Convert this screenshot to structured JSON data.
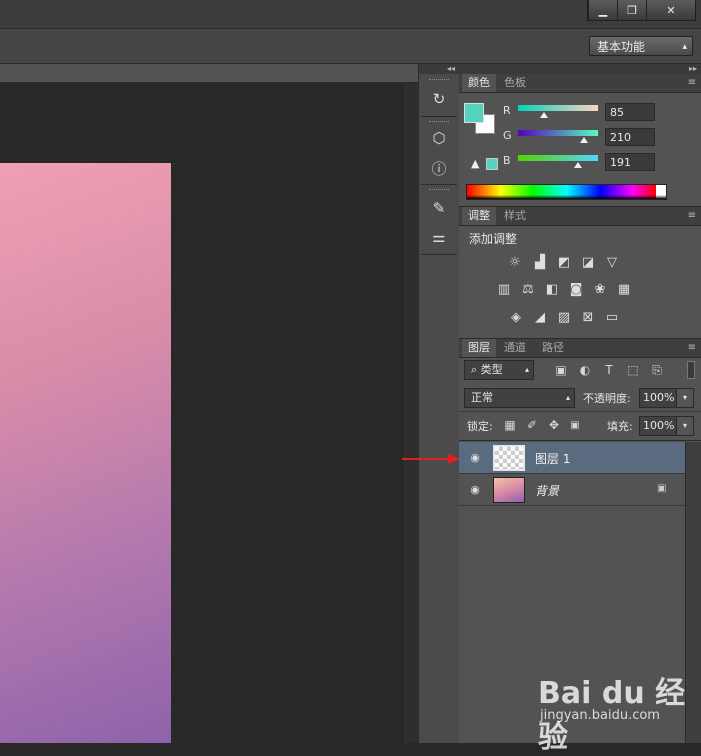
{
  "window": {
    "controls": [
      {
        "name": "minimize",
        "glyph": "▁"
      },
      {
        "name": "maximize",
        "glyph": "❐"
      },
      {
        "name": "close",
        "glyph": "✕"
      }
    ]
  },
  "optionsbar": {
    "workspace": "基本功能"
  },
  "tools": [
    {
      "icon": "history-icon",
      "glyph": "↻"
    },
    {
      "icon": "3d-cube-icon",
      "glyph": "⬡"
    },
    {
      "icon": "info-icon",
      "glyph": "ⓘ"
    },
    {
      "icon": "brushes-icon",
      "glyph": "✎"
    },
    {
      "icon": "brush-settings-icon",
      "glyph": "⚌"
    }
  ],
  "color_panel": {
    "tabs": [
      "颜色",
      "色板"
    ],
    "foreground": "#55d2bf",
    "background": "#ffffff",
    "channels": [
      {
        "label": "R",
        "value": "85",
        "fraction": 0.33,
        "grad": "linear-gradient(90deg,#00d2bf,#ffd2bf)"
      },
      {
        "label": "G",
        "value": "210",
        "fraction": 0.82,
        "grad": "linear-gradient(90deg,#5500bf,#55ffbf)"
      },
      {
        "label": "B",
        "value": "191",
        "fraction": 0.75,
        "grad": "linear-gradient(90deg,#55d200,#55d2ff)"
      }
    ],
    "gamut_warning_icon": "warning-icon"
  },
  "adjustments_panel": {
    "tabs": [
      "调整",
      "样式"
    ],
    "title": "添加调整",
    "rows": [
      [
        {
          "icon": "brightness-icon",
          "glyph": "☼"
        },
        {
          "icon": "levels-icon",
          "glyph": "▟"
        },
        {
          "icon": "curves-icon",
          "glyph": "◩"
        },
        {
          "icon": "exposure-icon",
          "glyph": "◪"
        },
        {
          "icon": "vibrance-icon",
          "glyph": "▽"
        }
      ],
      [
        {
          "icon": "hue-saturation-icon",
          "glyph": "▥"
        },
        {
          "icon": "color-balance-icon",
          "glyph": "⚖"
        },
        {
          "icon": "black-white-icon",
          "glyph": "◧"
        },
        {
          "icon": "photo-filter-icon",
          "glyph": "◙"
        },
        {
          "icon": "channel-mixer-icon",
          "glyph": "❀"
        },
        {
          "icon": "color-lookup-icon",
          "glyph": "▦"
        }
      ],
      [
        {
          "icon": "invert-icon",
          "glyph": "◈"
        },
        {
          "icon": "posterize-icon",
          "glyph": "◢"
        },
        {
          "icon": "threshold-icon",
          "glyph": "▨"
        },
        {
          "icon": "gradient-map-icon",
          "glyph": "⊠"
        },
        {
          "icon": "selective-color-icon",
          "glyph": "▭"
        }
      ]
    ]
  },
  "layers_panel": {
    "tabs": [
      "图层",
      "通道",
      "路径"
    ],
    "filter_kind": "类型",
    "filter_icons": [
      {
        "icon": "filter-pixel-icon",
        "glyph": "▣"
      },
      {
        "icon": "filter-adjustment-icon",
        "glyph": "◐"
      },
      {
        "icon": "filter-type-icon",
        "glyph": "T"
      },
      {
        "icon": "filter-shape-icon",
        "glyph": "⬚"
      },
      {
        "icon": "filter-smart-object-icon",
        "glyph": "⎘"
      }
    ],
    "blend_mode": "正常",
    "opacity_label": "不透明度:",
    "opacity_value": "100%",
    "lock_label": "锁定:",
    "lock_icons": [
      {
        "icon": "lock-transparent-icon",
        "glyph": "▦"
      },
      {
        "icon": "lock-paint-icon",
        "glyph": "✐"
      },
      {
        "icon": "lock-position-icon",
        "glyph": "✥"
      },
      {
        "icon": "lock-all-icon",
        "glyph": "🔒"
      }
    ],
    "fill_label": "填充:",
    "fill_value": "100%",
    "layers": [
      {
        "name": "图层 1",
        "selected": true,
        "thumb": "transparent"
      },
      {
        "name": "背景",
        "selected": false,
        "thumb": "gradient",
        "locked": true
      }
    ]
  },
  "annotation": {
    "arrow_color": "#e02020"
  },
  "watermark": {
    "logo": "Bai du 经验",
    "url": "jingyan.baidu.com"
  }
}
